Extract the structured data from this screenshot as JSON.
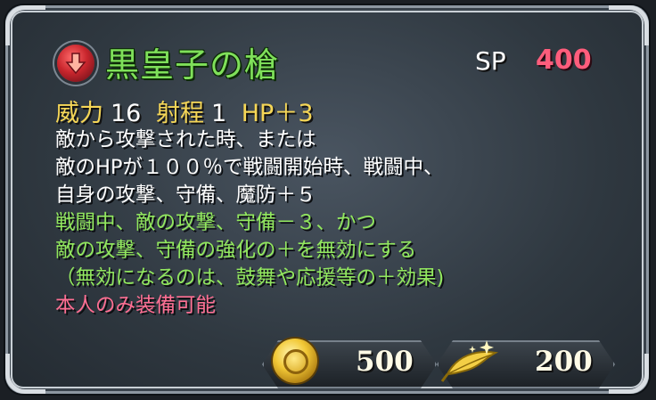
{
  "weapon": {
    "icon": "red-tome-weapon-icon",
    "name": "黒皇子の槍",
    "sp_label": "SP",
    "sp_value": "400"
  },
  "stats": {
    "might_label": "威力",
    "might_value": "16",
    "range_label": "射程",
    "range_value": "1",
    "hp_bonus": "HP＋3"
  },
  "description": {
    "white_lines": [
      "敵から攻撃された時、または",
      "敵のHPが１００％で戦闘開始時、戦闘中、",
      "自身の攻撃、守備、魔防＋５"
    ],
    "green_lines": [
      "戦闘中、敵の攻撃、守備－３、かつ",
      "敵の攻撃、守備の強化の＋を無効にする",
      "（無効になるのは、鼓舞や応援等の＋効果)"
    ],
    "pink_lines": [
      "本人のみ装備可能"
    ]
  },
  "costs": {
    "gold_icon": "gold-coin-icon",
    "gold_value": "500",
    "feather_icon": "hero-feather-icon",
    "feather_value": "200"
  },
  "colors": {
    "title_green": "#7fe05a",
    "sp_pink": "#ff5d7c",
    "stat_gold": "#f5d656",
    "effect_green": "#92e85e",
    "exclusive_pink": "#ff6f93"
  }
}
